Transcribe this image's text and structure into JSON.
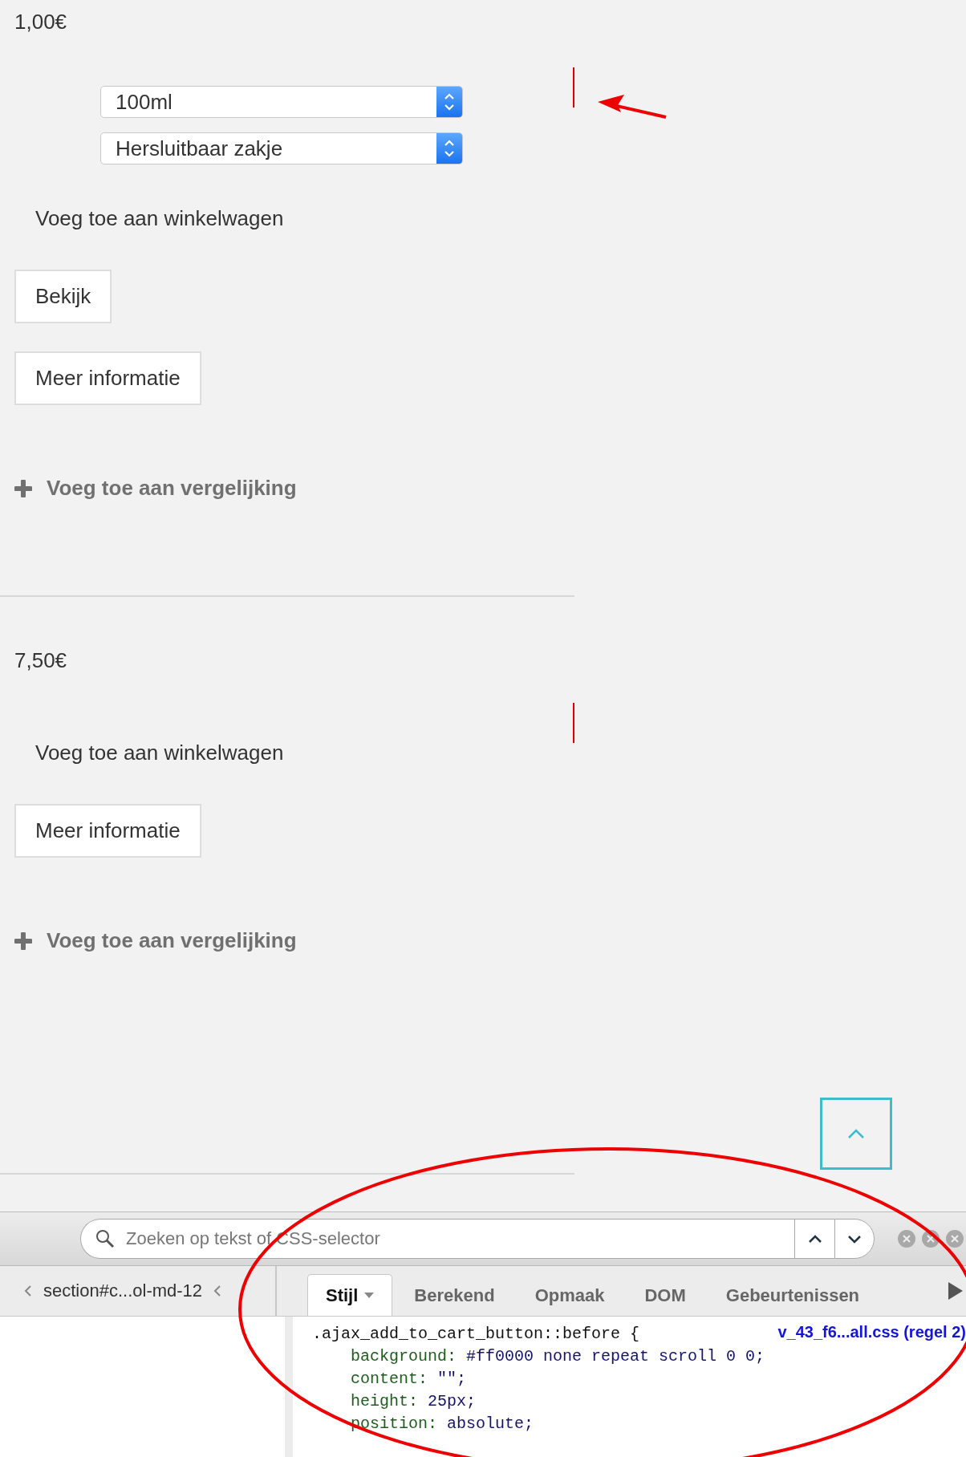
{
  "products": [
    {
      "price": "1,00€",
      "options": [
        {
          "value": "100ml"
        },
        {
          "value": "Hersluitbaar zakje"
        }
      ],
      "cart_marker": true,
      "add_to_cart": "Voeg toe aan winkelwagen",
      "buttons": [
        "Bekijk",
        "Meer informatie"
      ],
      "compare": "Voeg toe aan vergelijking"
    },
    {
      "price": "7,50€",
      "cart_marker": true,
      "add_to_cart": "Voeg toe aan winkelwagen",
      "buttons": [
        "Meer informatie"
      ],
      "compare": "Voeg toe aan vergelijking"
    }
  ],
  "annotations": {
    "arrow": true,
    "ellipse": true
  },
  "devtools": {
    "search": {
      "placeholder": "Zoeken op tekst of CSS-selector"
    },
    "breadcrumb": [
      "section#c...ol-md-12"
    ],
    "tabs": [
      {
        "label": "Stijl",
        "selected": true
      },
      {
        "label": "Berekend",
        "selected": false
      },
      {
        "label": "Opmaak",
        "selected": false
      },
      {
        "label": "DOM",
        "selected": false
      },
      {
        "label": "Gebeurtenissen",
        "selected": false
      }
    ],
    "rule": {
      "selector": ".ajax_add_to_cart_button::before {",
      "source": "v_43_f6...all.css (regel 2)",
      "declarations": [
        {
          "property": "background:",
          "value": "#ff0000 none repeat scroll 0 0;"
        },
        {
          "property": "content:",
          "value": "\"\";"
        },
        {
          "property": "height:",
          "value": "25px;"
        },
        {
          "property": "position:",
          "value": "absolute;"
        }
      ]
    }
  }
}
